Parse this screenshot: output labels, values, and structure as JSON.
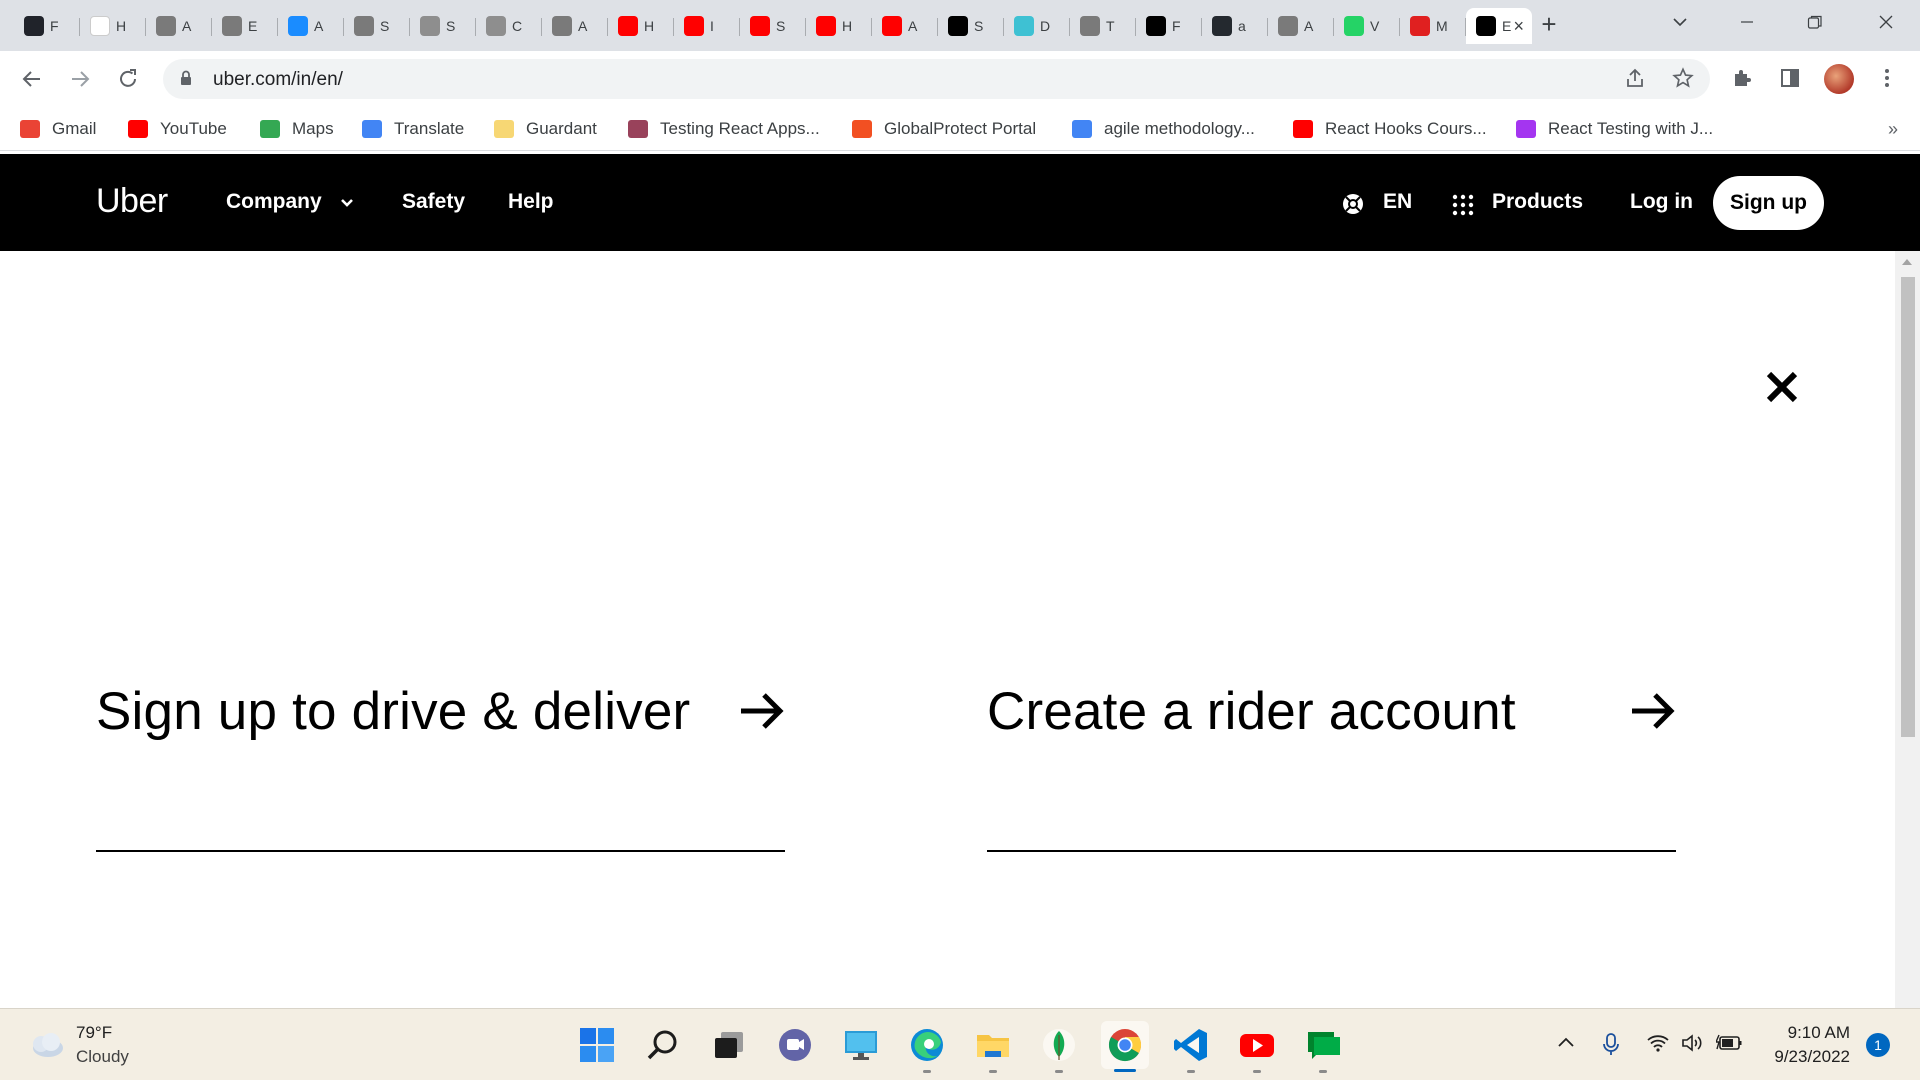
{
  "browser": {
    "tabs": [
      {
        "title": "F",
        "icon": "react-icon",
        "color": "#20232a"
      },
      {
        "title": "H",
        "icon": "google-icon",
        "color": "#ffffff"
      },
      {
        "title": "A",
        "icon": "apple-icon",
        "color": "#7a7a7a"
      },
      {
        "title": "E",
        "icon": "apple-icon",
        "color": "#7a7a7a"
      },
      {
        "title": "A",
        "icon": "app-store-icon",
        "color": "#1a8cff"
      },
      {
        "title": "S",
        "icon": "apple-icon",
        "color": "#7a7a7a"
      },
      {
        "title": "S",
        "icon": "apple-box-icon",
        "color": "#8e8e8e"
      },
      {
        "title": "C",
        "icon": "apple-box-icon",
        "color": "#8e8e8e"
      },
      {
        "title": "A",
        "icon": "apple-icon",
        "color": "#7a7a7a"
      },
      {
        "title": "H",
        "icon": "youtube-icon",
        "color": "#ff0000"
      },
      {
        "title": "I",
        "icon": "youtube-icon",
        "color": "#ff0000"
      },
      {
        "title": "S",
        "icon": "youtube-icon",
        "color": "#ff0000"
      },
      {
        "title": "H",
        "icon": "youtube-icon",
        "color": "#ff0000"
      },
      {
        "title": "A",
        "icon": "youtube-icon",
        "color": "#ff0000"
      },
      {
        "title": "S",
        "icon": "medium-icon",
        "color": "#000000"
      },
      {
        "title": "D",
        "icon": "swirl-icon",
        "color": "#3ec1d3"
      },
      {
        "title": "T",
        "icon": "apple-icon",
        "color": "#7a7a7a"
      },
      {
        "title": "F",
        "icon": "pluralsight-icon",
        "color": "#000000"
      },
      {
        "title": "a",
        "icon": "github-icon",
        "color": "#24292f"
      },
      {
        "title": "A",
        "icon": "apple-icon",
        "color": "#7a7a7a"
      },
      {
        "title": "V",
        "icon": "whatsapp-icon",
        "color": "#25d366"
      },
      {
        "title": "M",
        "icon": "record-icon",
        "color": "#e02020"
      },
      {
        "title": "E",
        "icon": "uber-icon",
        "color": "#000000"
      }
    ],
    "url": "uber.com/in/en/",
    "bookmarks": [
      {
        "label": "Gmail",
        "icon": "gmail-icon",
        "color": "#ea4335"
      },
      {
        "label": "YouTube",
        "icon": "youtube-icon",
        "color": "#ff0000"
      },
      {
        "label": "Maps",
        "icon": "maps-icon",
        "color": "#34a853"
      },
      {
        "label": "Translate",
        "icon": "translate-icon",
        "color": "#4285f4"
      },
      {
        "label": "Guardant",
        "icon": "folder-icon",
        "color": "#f7d774"
      },
      {
        "label": "Testing React Apps...",
        "icon": "jest-icon",
        "color": "#99425b"
      },
      {
        "label": "GlobalProtect Portal",
        "icon": "paloalto-icon",
        "color": "#f25022"
      },
      {
        "label": "agile methodology...",
        "icon": "google-icon",
        "color": "#4285f4"
      },
      {
        "label": "React Hooks Cours...",
        "icon": "youtube-icon",
        "color": "#ff0000"
      },
      {
        "label": "React Testing with J...",
        "icon": "udemy-icon",
        "color": "#a435f0"
      }
    ]
  },
  "uber": {
    "logo": "Uber",
    "nav": {
      "company": "Company",
      "safety": "Safety",
      "help": "Help",
      "language": "EN",
      "products": "Products",
      "login": "Log in",
      "signup": "Sign up"
    },
    "ctas": [
      {
        "label": "Sign up to drive & deliver"
      },
      {
        "label": "Create a rider account"
      }
    ]
  },
  "taskbar": {
    "weather": {
      "temp": "79°F",
      "condition": "Cloudy"
    },
    "time": "9:10 AM",
    "date": "9/23/2022",
    "notifications": "1"
  }
}
